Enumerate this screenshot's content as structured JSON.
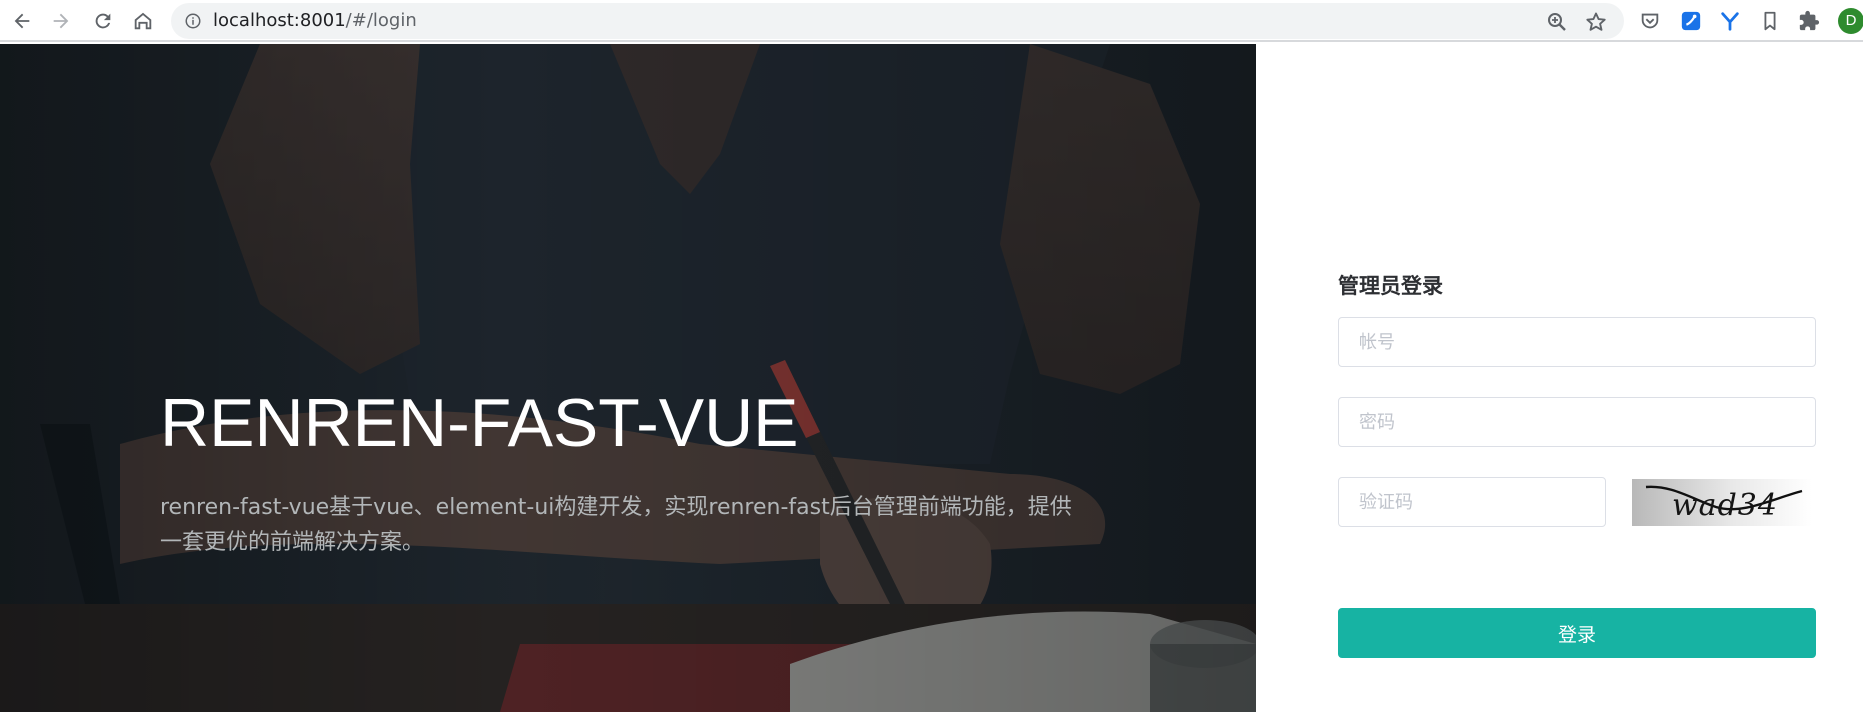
{
  "browser": {
    "url_host": "localhost:8001",
    "url_path": "/#/login",
    "profile_initial": "D",
    "profile_color": "#2e8b2e",
    "icons": [
      "back-icon",
      "forward-icon",
      "reload-icon",
      "home-icon",
      "site-info-icon",
      "zoom-icon",
      "bookmark-star-icon",
      "pocket-icon",
      "extension-blue-icon",
      "extension-y-icon",
      "reading-list-icon",
      "extensions-puzzle-icon"
    ]
  },
  "hero": {
    "title": "RENREN-FAST-VUE",
    "description": "renren-fast-vue基于vue、element-ui构建开发，实现renren-fast后台管理前端功能，提供一套更优的前端解决方案。"
  },
  "login": {
    "title": "管理员登录",
    "username_placeholder": "帐号",
    "username_value": "",
    "password_placeholder": "密码",
    "password_value": "",
    "captcha_placeholder": "验证码",
    "captcha_value": "",
    "captcha_image_text": "wad34",
    "submit_label": "登录",
    "accent_color": "#17b3a3"
  }
}
